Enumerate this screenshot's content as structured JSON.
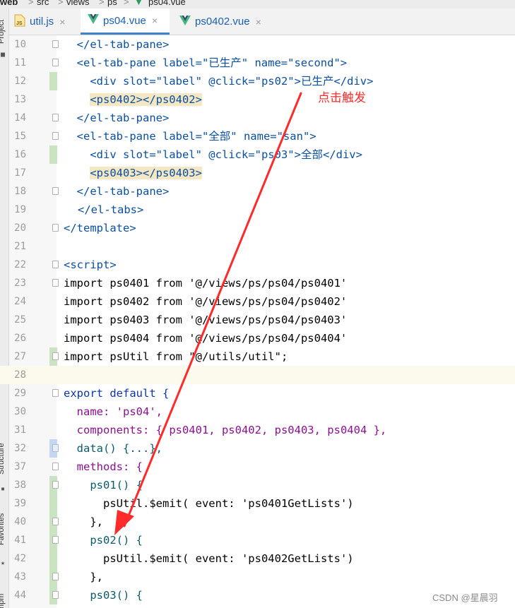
{
  "breadcrumb": {
    "project": "web",
    "path": [
      "src",
      "views",
      "ps"
    ],
    "file": "ps04.vue"
  },
  "tabs": [
    {
      "label": "util.js",
      "icon": "js-file-icon",
      "active": false
    },
    {
      "label": "ps04.vue",
      "icon": "vue-file-icon",
      "active": true
    },
    {
      "label": "ps0402.vue",
      "icon": "vue-file-icon",
      "active": false
    }
  ],
  "tab_close_glyph": "×",
  "side_panels": [
    "Project",
    "Structure",
    "Favorites",
    "npm"
  ],
  "lines": [
    {
      "num": "10",
      "indent": "  ",
      "code": "</el-tab-pane>"
    },
    {
      "num": "11",
      "indent": "  ",
      "code": "<el-tab-pane label=\"已生产\" name=\"second\">"
    },
    {
      "num": "12",
      "indent": "    ",
      "code": "<div slot=\"label\" @click=\"ps02\">已生产</div>"
    },
    {
      "num": "13",
      "indent": "    ",
      "code": "<ps0402></ps0402>"
    },
    {
      "num": "14",
      "indent": "  ",
      "code": "</el-tab-pane>"
    },
    {
      "num": "15",
      "indent": "  ",
      "code": "<el-tab-pane label=\"全部\" name=\"san\">"
    },
    {
      "num": "16",
      "indent": "    ",
      "code": "<div slot=\"label\" @click=\"ps03\">全部</div>"
    },
    {
      "num": "17",
      "indent": "    ",
      "code": "<ps0403></ps0403>"
    },
    {
      "num": "18",
      "indent": "  ",
      "code": "</el-tab-pane>"
    },
    {
      "num": "19",
      "indent": "",
      "code": "</el-tabs>"
    },
    {
      "num": "20",
      "indent": "",
      "code": "</template>"
    },
    {
      "num": "21",
      "indent": "",
      "code": ""
    },
    {
      "num": "22",
      "indent": "",
      "code": "<script>"
    },
    {
      "num": "23",
      "indent": "",
      "code": "import ps0401 from '@/views/ps/ps04/ps0401'"
    },
    {
      "num": "24",
      "indent": "",
      "code": "import ps0402 from '@/views/ps/ps04/ps0402'"
    },
    {
      "num": "25",
      "indent": "",
      "code": "import ps0403 from '@/views/ps/ps04/ps0403'"
    },
    {
      "num": "26",
      "indent": "",
      "code": "import ps0404 from '@/views/ps/ps04/ps0404'"
    },
    {
      "num": "27",
      "indent": "",
      "code": "import psUtil from \"@/utils/util\";"
    },
    {
      "num": "28",
      "indent": "",
      "code": ""
    },
    {
      "num": "29",
      "indent": "",
      "code": "export default {"
    },
    {
      "num": "30",
      "indent": "  ",
      "code": "name: 'ps04',"
    },
    {
      "num": "31",
      "indent": "  ",
      "code": "components: { ps0401, ps0402, ps0403, ps0404 },"
    },
    {
      "num": "32",
      "indent": "  ",
      "code": "data() {...},"
    },
    {
      "num": "37",
      "indent": "  ",
      "code": "methods: {"
    },
    {
      "num": "38",
      "indent": "    ",
      "code": "ps01() {"
    },
    {
      "num": "39",
      "indent": "      ",
      "code": "psUtil.$emit( event: 'ps0401GetLists')"
    },
    {
      "num": "40",
      "indent": "    ",
      "code": "},"
    },
    {
      "num": "41",
      "indent": "    ",
      "code": "ps02() {"
    },
    {
      "num": "42",
      "indent": "      ",
      "code": "psUtil.$emit( event: 'ps0402GetLists')"
    },
    {
      "num": "43",
      "indent": "    ",
      "code": "},"
    },
    {
      "num": "44",
      "indent": "    ",
      "code": "ps03() {"
    }
  ],
  "current_line": "28",
  "annotation": "点击触发",
  "watermark": "CSDN @星晨羽",
  "colors": {
    "arrow": "#ff2a2a",
    "tab_active_underline": "#4083c9",
    "current_line_bg": "#fcfaed"
  }
}
